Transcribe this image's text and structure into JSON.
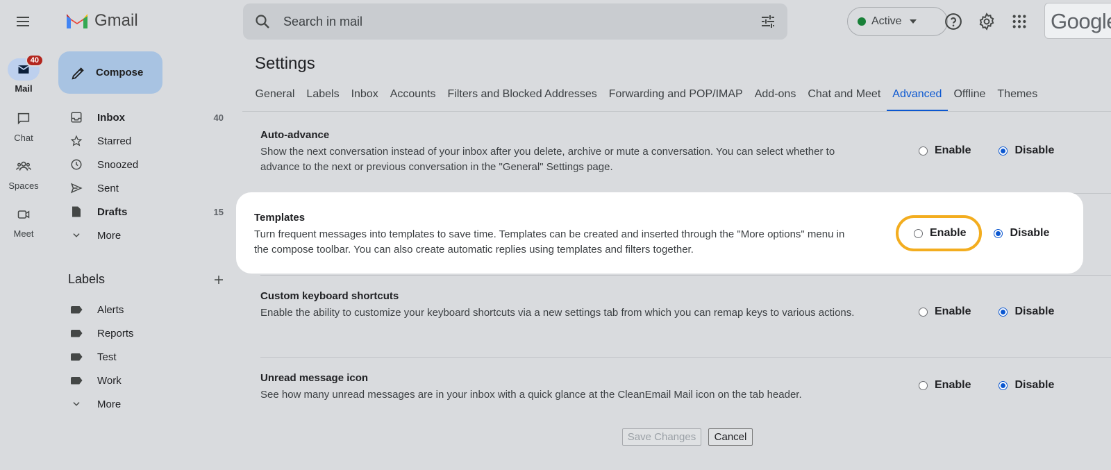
{
  "app": {
    "logo_text": "Gmail",
    "brand_text": "Google",
    "accent": "#0b57d0",
    "highlight_ring": "#f3ad1f"
  },
  "rail": {
    "items": [
      {
        "label": "Mail",
        "icon": "mail-icon",
        "badge": "40"
      },
      {
        "label": "Chat",
        "icon": "chat-icon"
      },
      {
        "label": "Spaces",
        "icon": "spaces-icon"
      },
      {
        "label": "Meet",
        "icon": "meet-icon"
      }
    ]
  },
  "sidebar": {
    "compose_label": "Compose",
    "items": [
      {
        "label": "Inbox",
        "icon": "inbox-icon",
        "count": "40"
      },
      {
        "label": "Starred",
        "icon": "star-icon",
        "count": ""
      },
      {
        "label": "Snoozed",
        "icon": "clock-icon",
        "count": ""
      },
      {
        "label": "Sent",
        "icon": "send-icon",
        "count": ""
      },
      {
        "label": "Drafts",
        "icon": "draft-icon",
        "count": "15"
      },
      {
        "label": "More",
        "icon": "chevron-down-icon",
        "count": ""
      }
    ],
    "labels_heading": "Labels",
    "labels": [
      {
        "label": "Alerts"
      },
      {
        "label": "Reports"
      },
      {
        "label": "Test"
      },
      {
        "label": "Work"
      }
    ],
    "labels_more": "More"
  },
  "search": {
    "placeholder": "Search in mail"
  },
  "status": {
    "label": "Active",
    "color": "#188038"
  },
  "settings": {
    "title": "Settings",
    "tabs": [
      {
        "label": "General"
      },
      {
        "label": "Labels"
      },
      {
        "label": "Inbox"
      },
      {
        "label": "Accounts"
      },
      {
        "label": "Filters and Blocked Addresses"
      },
      {
        "label": "Forwarding and POP/IMAP"
      },
      {
        "label": "Add-ons"
      },
      {
        "label": "Chat and Meet"
      },
      {
        "label": "Advanced"
      },
      {
        "label": "Offline"
      },
      {
        "label": "Themes"
      }
    ],
    "active_tab": "Advanced",
    "rows": [
      {
        "title": "Auto-advance",
        "description": "Show the next conversation instead of your inbox after you delete, archive or mute a conversation. You can select whether to advance to the next or previous conversation in the \"General\" Settings page.",
        "enable_label": "Enable",
        "disable_label": "Disable",
        "selected": "Disable"
      },
      {
        "title": "Templates",
        "description": "Turn frequent messages into templates to save time. Templates can be created and inserted through the \"More options\" menu in the compose toolbar. You can also create automatic replies using templates and filters together.",
        "enable_label": "Enable",
        "disable_label": "Disable",
        "selected": "Disable"
      },
      {
        "title": "Custom keyboard shortcuts",
        "description": "Enable the ability to customize your keyboard shortcuts via a new settings tab from which you can remap keys to various actions.",
        "enable_label": "Enable",
        "disable_label": "Disable",
        "selected": "Disable"
      },
      {
        "title": "Unread message icon",
        "description": "See how many unread messages are in your inbox with a quick glance at the CleanEmail Mail icon on the tab header.",
        "enable_label": "Enable",
        "disable_label": "Disable",
        "selected": "Disable"
      }
    ],
    "save_label": "Save Changes",
    "cancel_label": "Cancel"
  }
}
